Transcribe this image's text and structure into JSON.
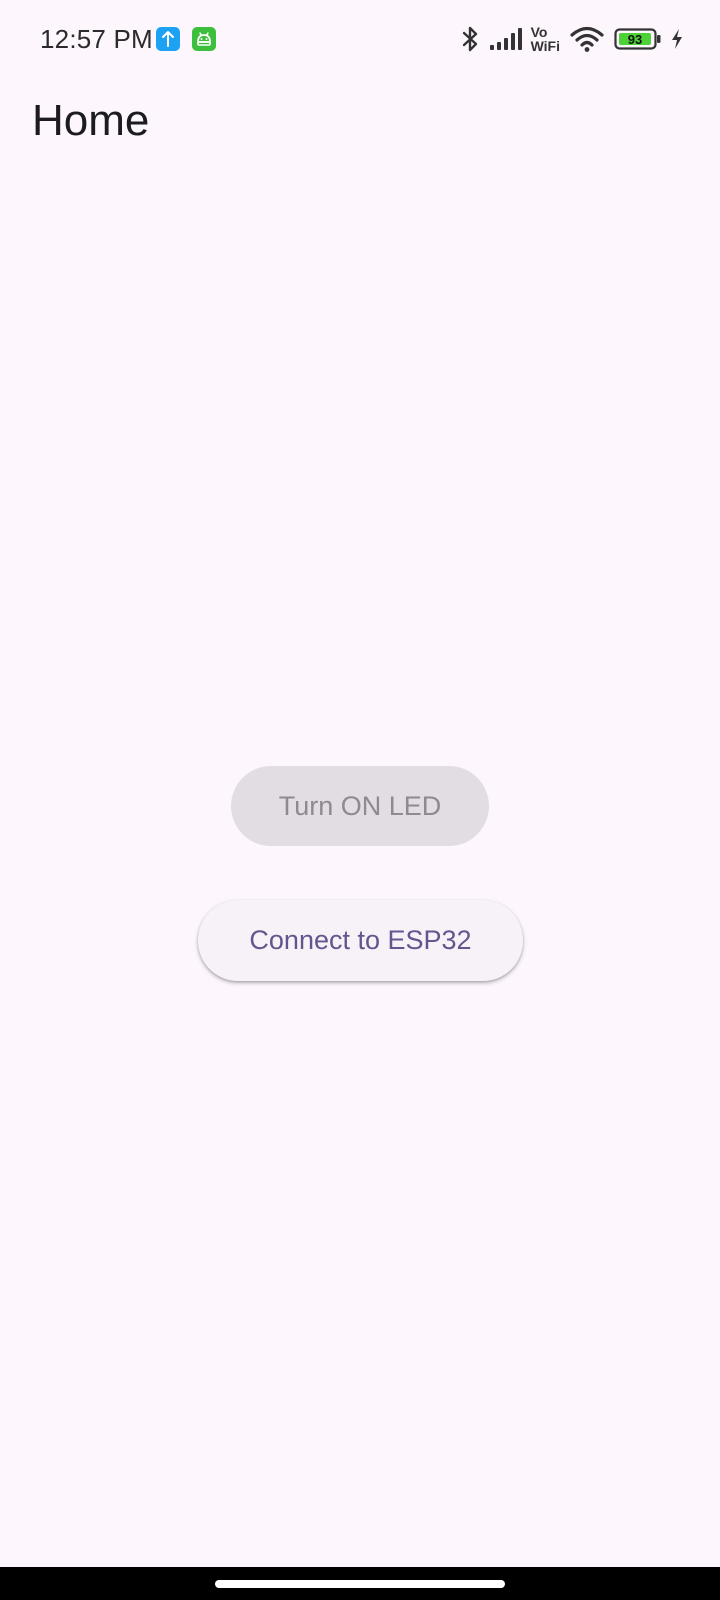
{
  "status_bar": {
    "time": "12:57 PM",
    "notifications": [
      {
        "icon": "upload-arrow-icon",
        "color": "#1da1f2"
      },
      {
        "icon": "android-robot-icon",
        "color": "#3cbf3c"
      }
    ],
    "icons": [
      "bluetooth-icon",
      "signal-icon",
      "vowifi-icon",
      "wifi-icon",
      "battery-icon",
      "charging-icon"
    ],
    "vowifi_top": "Vo",
    "vowifi_bottom": "WiFi",
    "battery_level": "93",
    "battery_color": "#4cd137"
  },
  "app_bar": {
    "title": "Home"
  },
  "main": {
    "led_button_label": "Turn ON LED",
    "led_button_enabled": false,
    "connect_button_label": "Connect to ESP32"
  },
  "colors": {
    "background": "#fdf7fd",
    "primary": "#65558f",
    "disabled_bg": "#e2dce3",
    "disabled_text": "#8e8a91"
  }
}
